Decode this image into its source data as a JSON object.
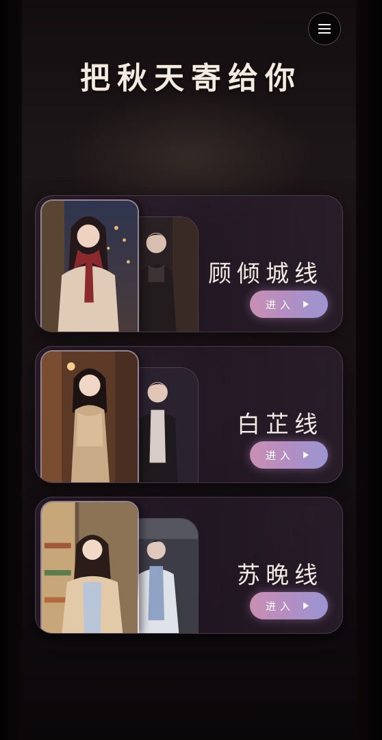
{
  "header": {
    "title": "把秋天寄给你",
    "menu_icon": "menu-icon"
  },
  "routes": [
    {
      "name": "顾倾城线",
      "enter_label": "进入",
      "enter_icon": "play-icon",
      "art": "autumn-night-couple-illustration"
    },
    {
      "name": "白芷线",
      "enter_label": "进入",
      "enter_icon": "play-icon",
      "art": "evening-dress-couple-illustration"
    },
    {
      "name": "苏晚线",
      "enter_label": "进入",
      "enter_icon": "play-icon",
      "art": "cafe-doctor-couple-illustration"
    }
  ],
  "colors": {
    "button_gradient_start": "#c98fb3",
    "button_gradient_end": "#9a96d2",
    "title_text": "#f3ebe0",
    "background": "#070506"
  }
}
